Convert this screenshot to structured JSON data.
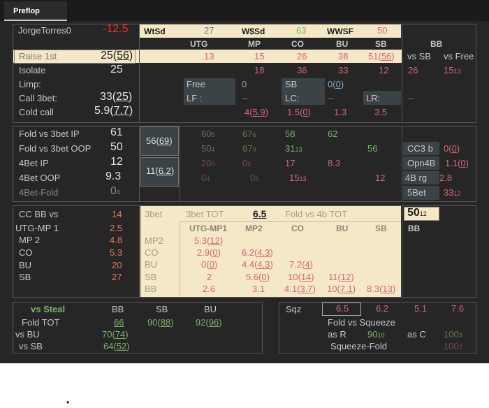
{
  "tab": "Preflop",
  "header": {
    "player": "JorgeTorres0",
    "winnings": "-12.5",
    "wtsd_label": "WtSd",
    "wtsd": "27",
    "wssd_label": "W$Sd",
    "wssd": "63",
    "wwsf_label": "WWSF",
    "wwsf": "50"
  },
  "positions": {
    "utg": "UTG",
    "mp": "MP",
    "co": "CO",
    "bu": "BU",
    "sb": "SB",
    "bb": "BB"
  },
  "raise1st": {
    "label": "Raise 1st",
    "val": "25",
    "cnt": "56",
    "utg": "13",
    "mp": "15",
    "co": "26",
    "bu": "38",
    "sb": "51",
    "sb_cnt": "56",
    "vs_sb": "vs SB",
    "vs_free": "vs Free"
  },
  "isolate": {
    "label": "Isolate",
    "val": "25",
    "mp": "18",
    "co": "36",
    "bu": "33",
    "sb": "12",
    "bb": "26",
    "bb2": "15",
    "bb2_cnt": "13"
  },
  "limp": {
    "label": "Limp:",
    "free": "Free",
    "free_val": "0",
    "sb": "SB",
    "sb_val": "0",
    "sb_cnt": "0"
  },
  "call3bet": {
    "label": "Call 3bet:",
    "val": "33",
    "cnt": "25",
    "lf": "LF :",
    "lf_val": "--",
    "lc": "LC:",
    "lc_val": "--",
    "lr": "LR:",
    "lr_val": "--",
    "bb": "--"
  },
  "coldcall": {
    "label": "Cold call",
    "val": "5.9",
    "cnt": "7.7",
    "mp": "4",
    "mp_cnt": "5.9",
    "co": "1.5",
    "co_cnt": "0",
    "bu": "1.3",
    "sb": "3.5"
  },
  "fold3ip": {
    "label": "Fold vs 3bet IP",
    "val": "61",
    "utg": "60",
    "utg_cnt": "5",
    "mp": "67",
    "mp_cnt": "6",
    "co": "58",
    "bu": "62"
  },
  "fold3oop": {
    "label": "Fold vs 3bet OOP",
    "val": "50",
    "utg": "50",
    "utg_cnt": "4",
    "mp": "67",
    "mp_cnt": "9",
    "co": "31",
    "co_cnt": "13",
    "sb": "56",
    "cc3b": "CC3 b",
    "cc3b_val": "0",
    "cc3b_cnt": "0"
  },
  "bet4ip": {
    "label": "4Bet IP",
    "val": "12",
    "utg": "20",
    "utg_cnt": "5",
    "mp": "0",
    "mp_cnt": "5",
    "co": "17",
    "bu": "8.3",
    "opn4b": "Opn4B",
    "opn4b_val": "1.1",
    "opn4b_cnt": "0"
  },
  "bet4oop": {
    "label": "4Bet OOP",
    "val": "9.3",
    "utg": "0",
    "utg_cnt": "4",
    "mp": "0",
    "mp_cnt": "9",
    "co": "15",
    "co_cnt": "13",
    "sb": "12",
    "rg": "4B rg",
    "rg_val": "2.8"
  },
  "bet4fold": {
    "label": "4Bet-Fold",
    "val": "0",
    "cnt": "4",
    "bet5": "5Bet",
    "bet5_val": "33",
    "bet5_cnt": "12"
  },
  "slate1": {
    "val": "56",
    "cnt": "69"
  },
  "slate2": {
    "val": "11",
    "cnt": "6.2"
  },
  "ccbb": {
    "label": "CC BB vs",
    "val": "14",
    "rows": [
      {
        "label": "UTG-MP 1",
        "val": "2.5"
      },
      {
        "label": "MP 2",
        "val": "4.8"
      },
      {
        "label": "CO",
        "val": "5.3"
      },
      {
        "label": "BU",
        "val": "20"
      },
      {
        "label": "SB",
        "val": "27"
      }
    ]
  },
  "threebet": {
    "label": "3bet",
    "tot_label": "3bet TOT",
    "tot": "6.5",
    "fold4_label": "Fold vs 4b TOT",
    "fold4": "50",
    "fold4_cnt": "12",
    "cols": {
      "utgmp1": "UTG-MP1",
      "mp2": "MP2",
      "co": "CO",
      "bu": "BU",
      "sb": "SB",
      "bb": "BB"
    },
    "rows": {
      "mp2": "MP2",
      "co": "CO",
      "bu": "BU",
      "sb": "SB",
      "bb": "BB"
    },
    "mp2_utg": "5.3",
    "mp2_utg_cnt": "12",
    "co_utg": "2.9",
    "co_utg_cnt": "0",
    "co_mp": "6.2",
    "co_mp_cnt": "4.3",
    "bu_utg": "0",
    "bu_utg_cnt": "0",
    "bu_mp": "4.4",
    "bu_mp_cnt": "4.3",
    "bu_co": "7.2",
    "bu_co_cnt": "4",
    "sb_utg": "2",
    "sb_mp": "5.6",
    "sb_mp_cnt": "0",
    "sb_co": "10",
    "sb_co_cnt": "14",
    "sb_bu": "11",
    "sb_bu_cnt": "12",
    "bb_utg": "2.6",
    "bb_mp": "3.1",
    "bb_co": "4.1",
    "bb_co_cnt": "3.7",
    "bb_bu": "10",
    "bb_bu_cnt": "7.1",
    "bb_sb": "8.3",
    "bb_sb_cnt": "13"
  },
  "steal": {
    "title": "vs Steal",
    "bb": "BB",
    "sb": "SB",
    "bu": "BU",
    "foldtot_label": "Fold TOT",
    "foldtot_bb": "66",
    "foldtot_sb": "90",
    "foldtot_sb_cnt": "88",
    "foldtot_bu": "92",
    "foldtot_bu_cnt": "96",
    "vsbu_label": "vs BU",
    "vsbu_bb": "70",
    "vsbu_bb_cnt": "74",
    "vssb_label": "vs SB",
    "vssb_bb": "64",
    "vssb_bb_cnt": "52"
  },
  "squeeze": {
    "label": "Sqz",
    "v1": "6.5",
    "v2": "6.2",
    "v3": "5.1",
    "v4": "7.6",
    "fold_label": "Fold vs Squeeze",
    "asr_label": "as R",
    "asr": "90",
    "asr_cnt": "10",
    "asc_label": "as C",
    "asc": "100",
    "asc_cnt": "3",
    "sqfold_label": "Squeeze-Fold",
    "sqfold": "100",
    "sqfold_cnt": "2"
  },
  "bullet": "•"
}
